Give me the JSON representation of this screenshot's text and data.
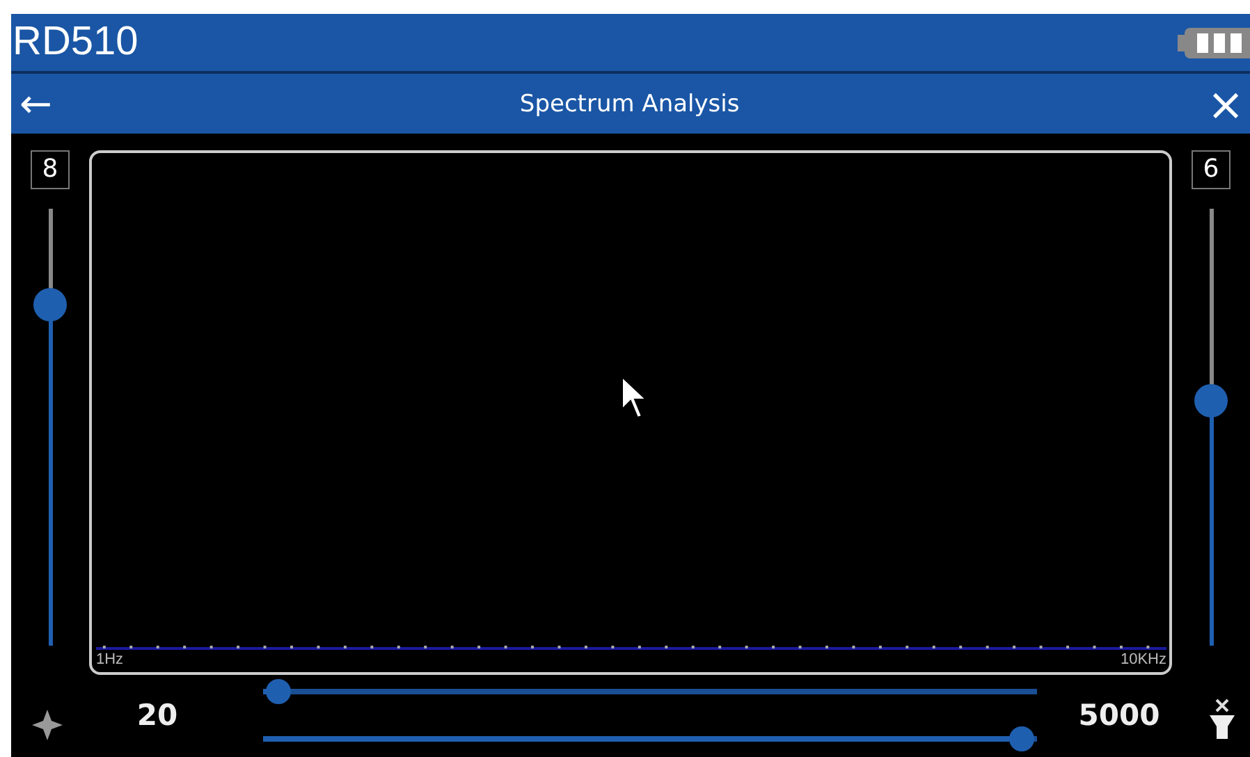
{
  "device": {
    "name": "RD510"
  },
  "title_bar": {
    "back": "←",
    "title": "Spectrum Analysis",
    "close": "×"
  },
  "left_slider": {
    "value": "8",
    "level": 0.78
  },
  "right_slider": {
    "value": "6",
    "level": 0.56
  },
  "spectrum": {
    "min_label": "1Hz",
    "max_label": "10KHz"
  },
  "range": {
    "low": "20",
    "high": "5000",
    "sliders": [
      {
        "level": 0.02
      },
      {
        "level": 0.98
      }
    ]
  }
}
